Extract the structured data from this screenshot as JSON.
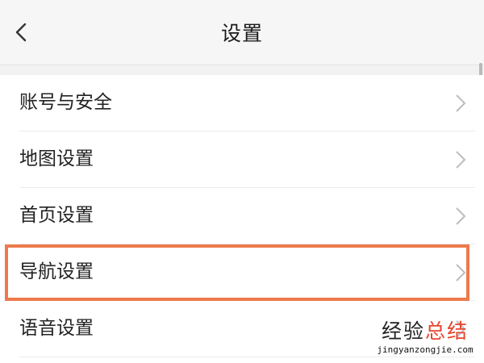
{
  "header": {
    "title": "设置"
  },
  "items": [
    {
      "label": "账号与安全"
    },
    {
      "label": "地图设置"
    },
    {
      "label": "首页设置"
    },
    {
      "label": "导航设置"
    },
    {
      "label": "语音设置"
    }
  ],
  "highlight": {
    "color": "#ed7a4c",
    "target": "导航设置"
  },
  "icons": {
    "back": "chevron-left-icon",
    "row_arrow": "chevron-right-icon"
  },
  "watermark": {
    "part1": "经验",
    "part2": "总结",
    "url": "jingyanzongjie.com",
    "accent_color": "#e8452e"
  }
}
